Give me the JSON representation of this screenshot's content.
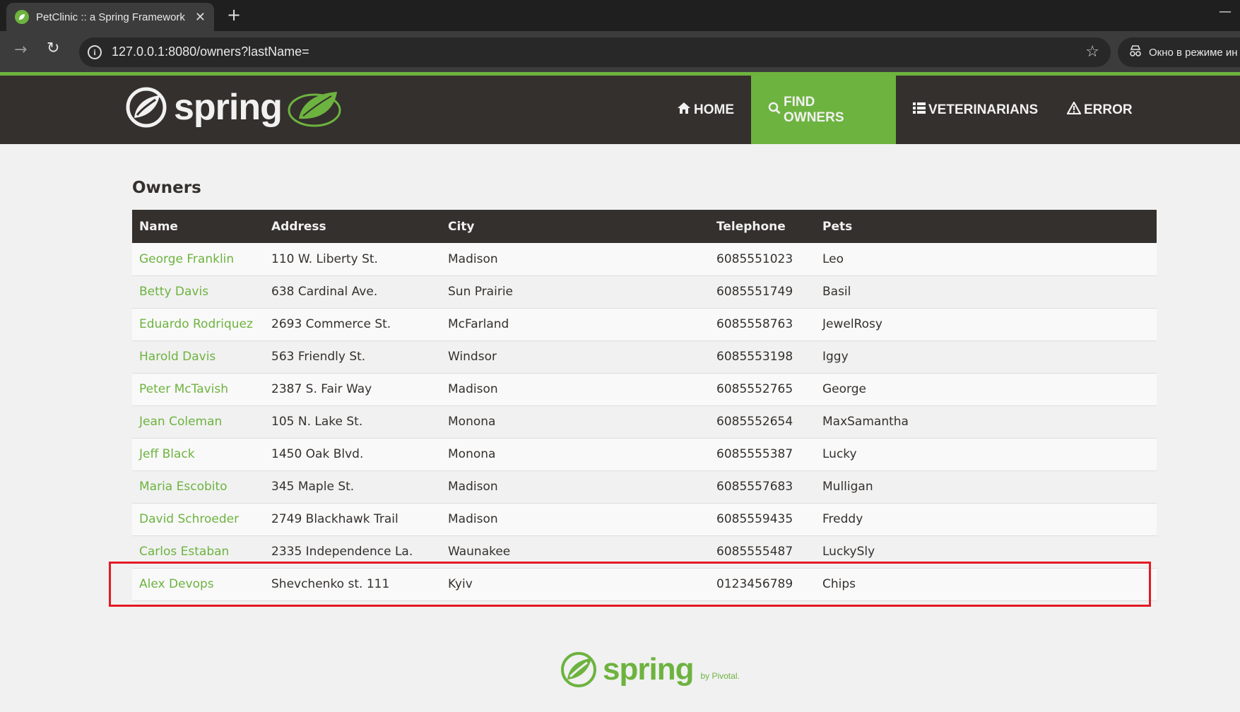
{
  "browser": {
    "tab_title": "PetClinic :: a Spring Framework",
    "tab_close": "✕",
    "new_tab": "+",
    "minimize": "—",
    "url": "127.0.0.1:8080/owners?lastName=",
    "incognito_label": "Окно в режиме ин"
  },
  "navbar": {
    "brand": "spring",
    "items": [
      {
        "label": "HOME",
        "icon": "home-icon",
        "active": false
      },
      {
        "label": "FIND OWNERS",
        "icon": "search-icon",
        "active": true
      },
      {
        "label": "VETERINARIANS",
        "icon": "list-icon",
        "active": false
      },
      {
        "label": "ERROR",
        "icon": "warning-icon",
        "active": false
      }
    ]
  },
  "page": {
    "heading": "Owners",
    "columns": [
      "Name",
      "Address",
      "City",
      "Telephone",
      "Pets"
    ],
    "rows": [
      {
        "name": "George Franklin",
        "address": "110 W. Liberty St.",
        "city": "Madison",
        "telephone": "6085551023",
        "pets": "Leo"
      },
      {
        "name": "Betty Davis",
        "address": "638 Cardinal Ave.",
        "city": "Sun Prairie",
        "telephone": "6085551749",
        "pets": "Basil"
      },
      {
        "name": "Eduardo Rodriquez",
        "address": "2693 Commerce St.",
        "city": "McFarland",
        "telephone": "6085558763",
        "pets": "JewelRosy"
      },
      {
        "name": "Harold Davis",
        "address": "563 Friendly St.",
        "city": "Windsor",
        "telephone": "6085553198",
        "pets": "Iggy"
      },
      {
        "name": "Peter McTavish",
        "address": "2387 S. Fair Way",
        "city": "Madison",
        "telephone": "6085552765",
        "pets": "George"
      },
      {
        "name": "Jean Coleman",
        "address": "105 N. Lake St.",
        "city": "Monona",
        "telephone": "6085552654",
        "pets": "MaxSamantha"
      },
      {
        "name": "Jeff Black",
        "address": "1450 Oak Blvd.",
        "city": "Monona",
        "telephone": "6085555387",
        "pets": "Lucky"
      },
      {
        "name": "Maria Escobito",
        "address": "345 Maple St.",
        "city": "Madison",
        "telephone": "6085557683",
        "pets": "Mulligan"
      },
      {
        "name": "David Schroeder",
        "address": "2749 Blackhawk Trail",
        "city": "Madison",
        "telephone": "6085559435",
        "pets": "Freddy"
      },
      {
        "name": "Carlos Estaban",
        "address": "2335 Independence La.",
        "city": "Waunakee",
        "telephone": "6085555487",
        "pets": "LuckySly"
      },
      {
        "name": "Alex Devops",
        "address": "Shevchenko st. 111",
        "city": "Kyiv",
        "telephone": "0123456789",
        "pets": "Chips"
      }
    ]
  },
  "footer": {
    "brand": "spring",
    "by": "by Pivotal."
  },
  "colors": {
    "brand_green": "#6db33f",
    "navbar_dark": "#34302d",
    "highlight_red": "#e31b23"
  }
}
